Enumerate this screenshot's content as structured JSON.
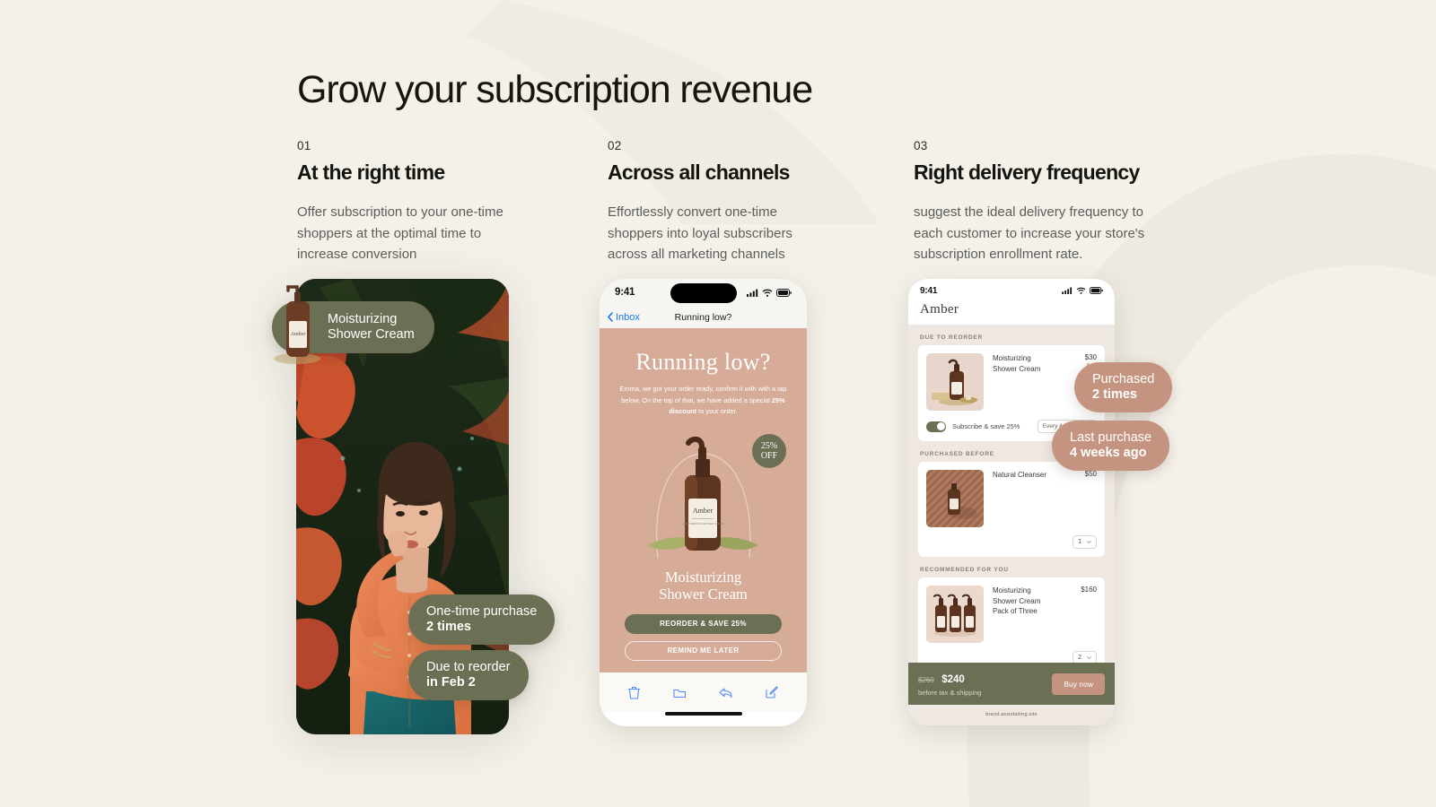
{
  "theme": {
    "bg": "#f4f1ea",
    "olive": "#6b7055",
    "clay": "#c59480",
    "mail_bg": "#d6ab98",
    "ink": "#16160f"
  },
  "headline": "Grow your subscription revenue",
  "columns": [
    {
      "number": "01",
      "title": "At the right time",
      "body": "Offer subscription to your one-time shoppers at the optimal time to increase conversion"
    },
    {
      "number": "02",
      "title": "Across all channels",
      "body": "Effortlessly convert one-time shoppers into loyal subscribers across all marketing channels"
    },
    {
      "number": "03",
      "title": "Right delivery frequency",
      "body": "suggest the ideal delivery frequency to each customer to increase your store's subscription enrollment rate."
    }
  ],
  "phone1": {
    "product_badge": {
      "line1": "Moisturizing",
      "line2": "Shower Cream"
    },
    "badges": [
      {
        "top": "One-time purchase",
        "bottom": "2 times"
      },
      {
        "top": "Due to reorder",
        "bottom": "in Feb 2"
      }
    ]
  },
  "phone2": {
    "status": {
      "time": "9:41"
    },
    "nav": {
      "back": "Inbox",
      "title": "Running low?"
    },
    "email": {
      "heading": "Running low?",
      "body_pre": "Emma, we got your order ready, confirm it with with a tap below. On the top of that, we have added a special ",
      "body_bold": "25% discount",
      "body_post": " to your order.",
      "off_badge_top": "25%",
      "off_badge_bottom": "OFF",
      "product_line1": "Moisturizing",
      "product_line2": "Shower Cream",
      "primary_button": "REORDER & SAVE 25%",
      "secondary_button": "REMIND ME LATER"
    },
    "tabbar": [
      "trash-icon",
      "folder-icon",
      "reply-icon",
      "compose-icon"
    ]
  },
  "phone3": {
    "status": {
      "time": "9:41"
    },
    "brand": "Amber",
    "sections": [
      {
        "label": "DUE TO REORDER",
        "product": {
          "name_line1": "Moisturizing",
          "name_line2": "Shower Cream",
          "price": "$30",
          "old_price": "$40"
        },
        "subscribe_label": "Subscribe & save 25%",
        "frequency": "Every 4 weeks",
        "toggle_on": true
      },
      {
        "label": "PURCHASED BEFORE",
        "product": {
          "name_line1": "Natural Cleanser",
          "price": "$50"
        },
        "qty": "1"
      },
      {
        "label": "RECOMMENDED FOR YOU",
        "product": {
          "name_line1": "Moisturizing",
          "name_line2": "Shower Cream",
          "name_line3": "Pack of Three",
          "price": "$160"
        },
        "qty": "2"
      }
    ],
    "footer": {
      "old_total": "$260",
      "total": "$240",
      "note": "before tax & shipping",
      "buy_label": "Buy now"
    },
    "url": "brand.assistalong.site",
    "badges": [
      {
        "top": "Purchased",
        "bottom": "2 times"
      },
      {
        "top": "Last purchase",
        "bottom": "4 weeks ago"
      }
    ]
  }
}
